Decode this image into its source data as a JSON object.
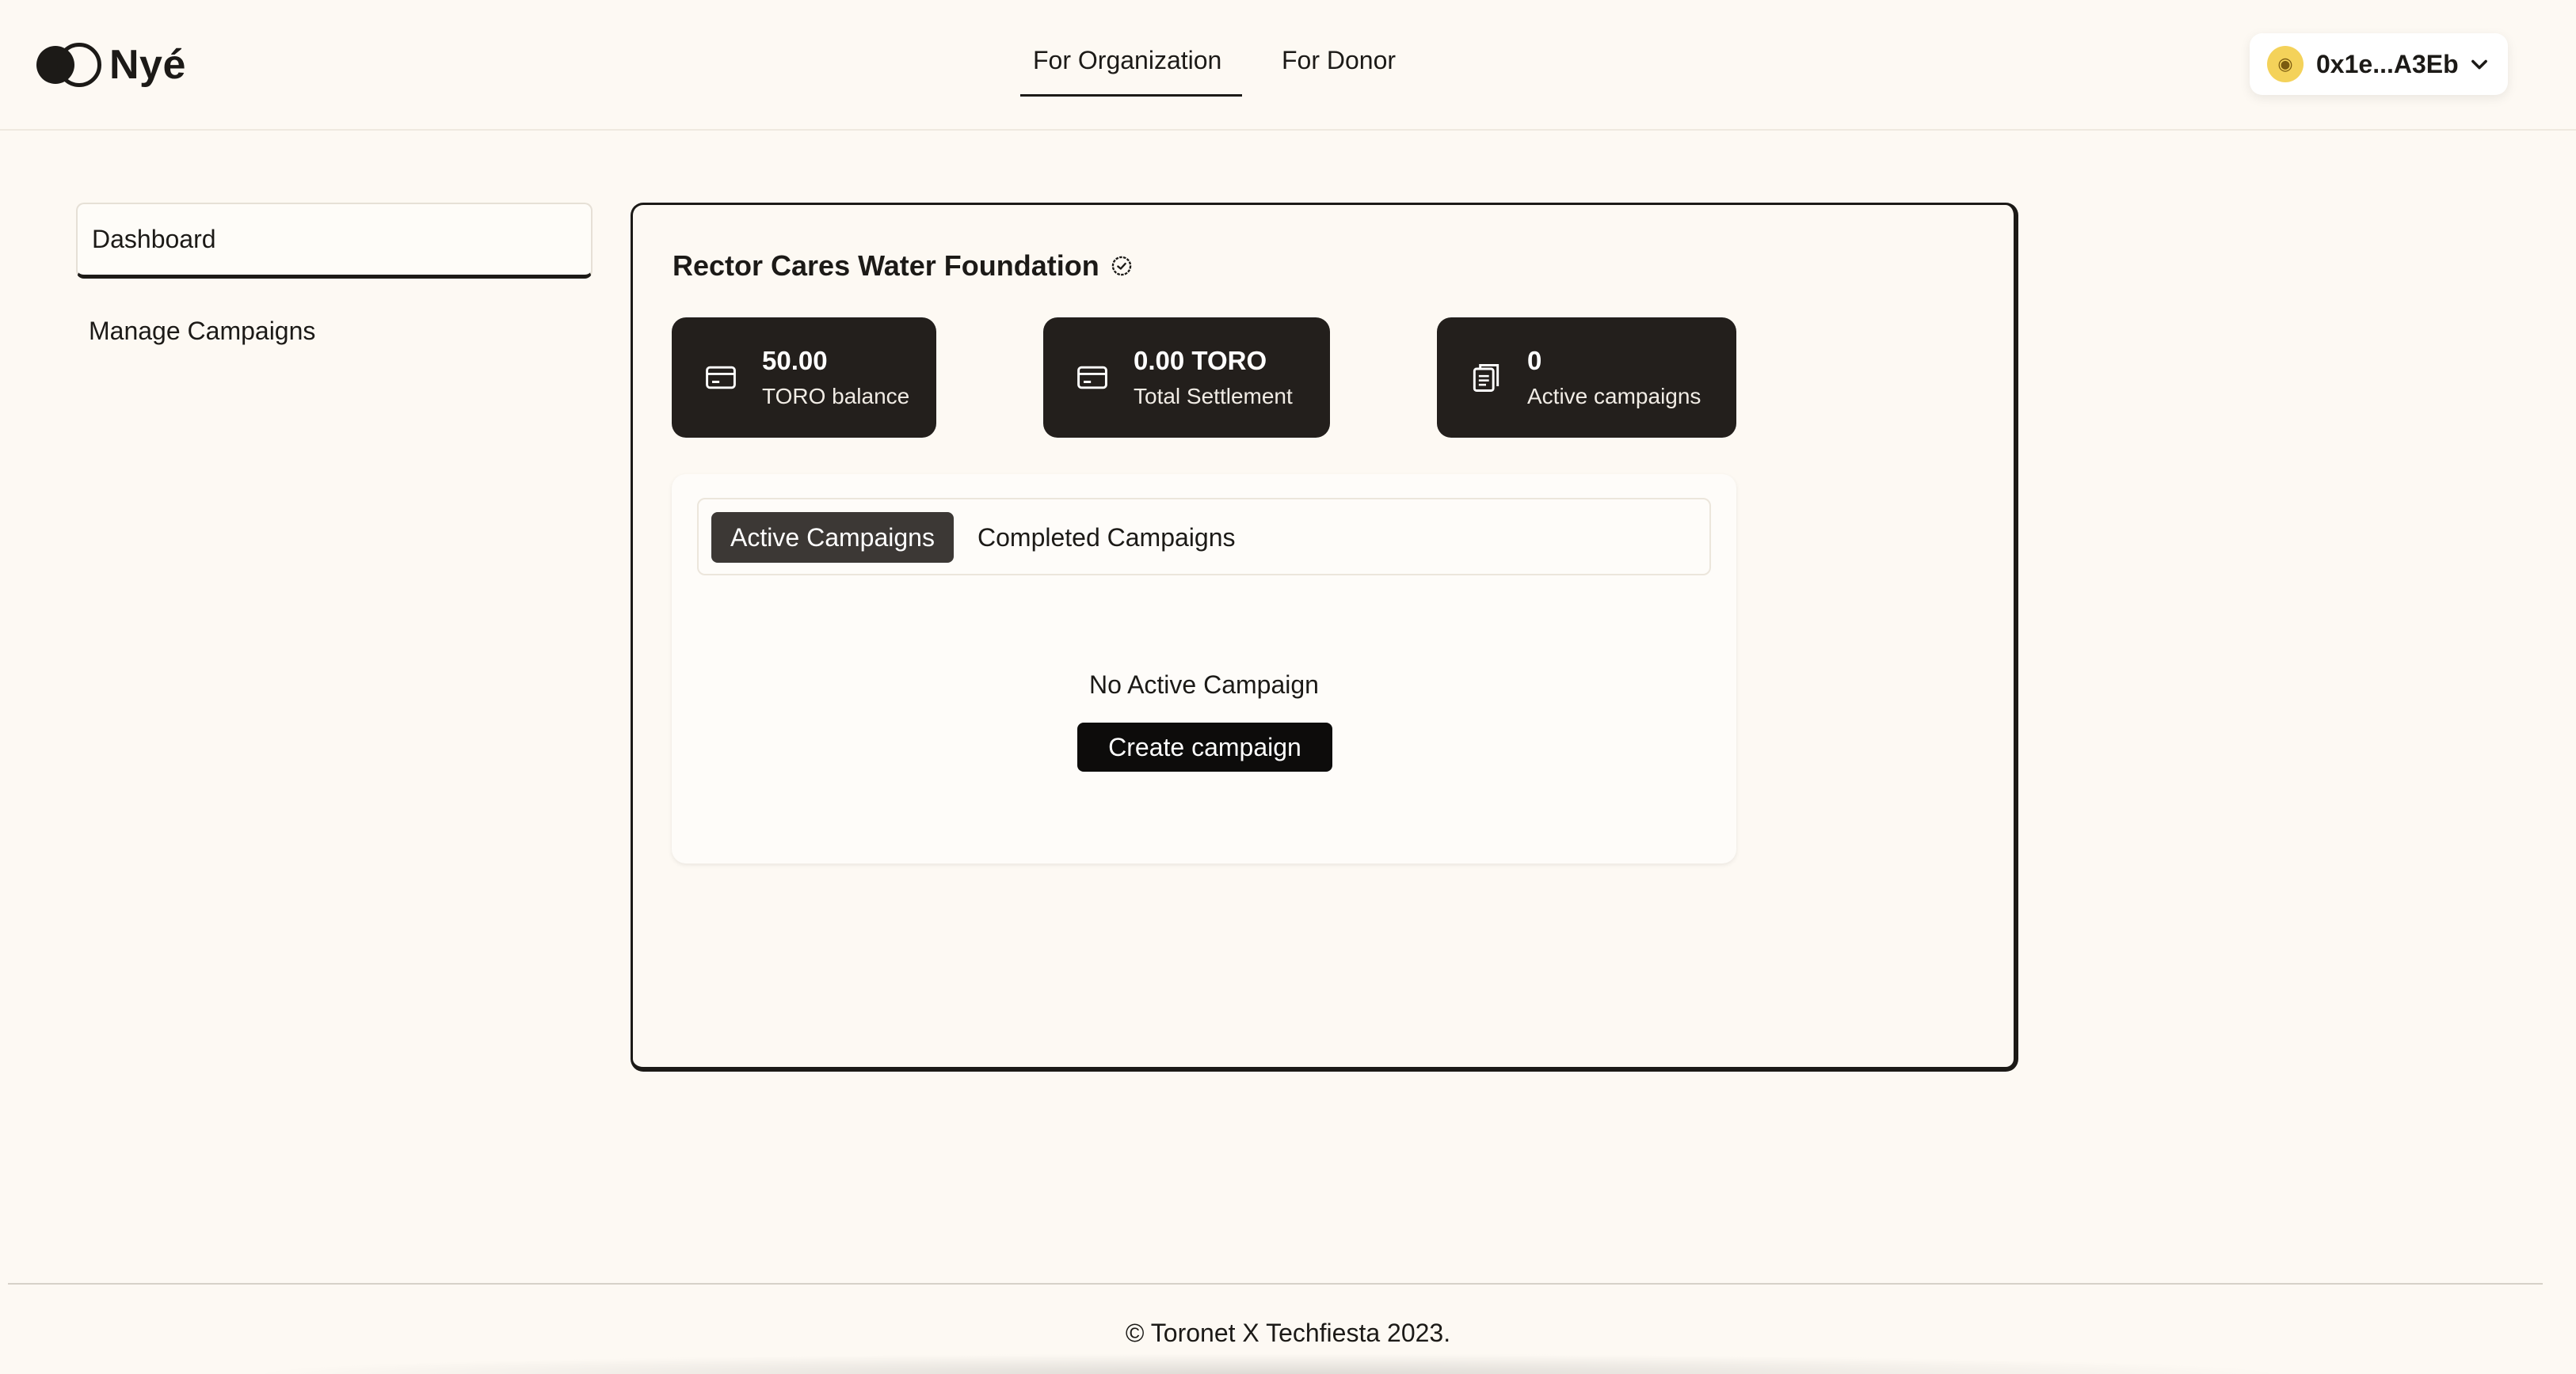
{
  "header": {
    "brand": "Nyé",
    "nav": [
      {
        "label": "For Organization",
        "active": true
      },
      {
        "label": "For Donor",
        "active": false
      }
    ],
    "wallet": {
      "address": "0x1e...A3Eb",
      "avatar_icon": "cat-avatar-icon",
      "dropdown_icon": "chevron-down-icon"
    }
  },
  "sidebar": {
    "items": [
      {
        "label": "Dashboard",
        "active": true
      },
      {
        "label": "Manage Campaigns",
        "active": false
      }
    ]
  },
  "main": {
    "org_name": "Rector Cares Water Foundation",
    "verified_icon": "verified-check-icon",
    "stats": [
      {
        "value": "50.00",
        "label": "TORO balance",
        "icon": "credit-card-icon"
      },
      {
        "value": "0.00 TORO",
        "label": "Total Settlement",
        "icon": "credit-card-icon"
      },
      {
        "value": "0",
        "label": "Active campaigns",
        "icon": "clipboard-icon"
      }
    ],
    "tabs": [
      {
        "label": "Active Campaigns",
        "active": true
      },
      {
        "label": "Completed Campaigns",
        "active": false
      }
    ],
    "empty_state": "No Active Campaign",
    "create_button": "Create campaign"
  },
  "footer": {
    "copyright": "© Toronet X Techfiesta 2023."
  },
  "colors": {
    "background": "#fdf9f3",
    "dark": "#231f1c",
    "tab_active": "#3c3835",
    "button": "#0d0c0b"
  }
}
